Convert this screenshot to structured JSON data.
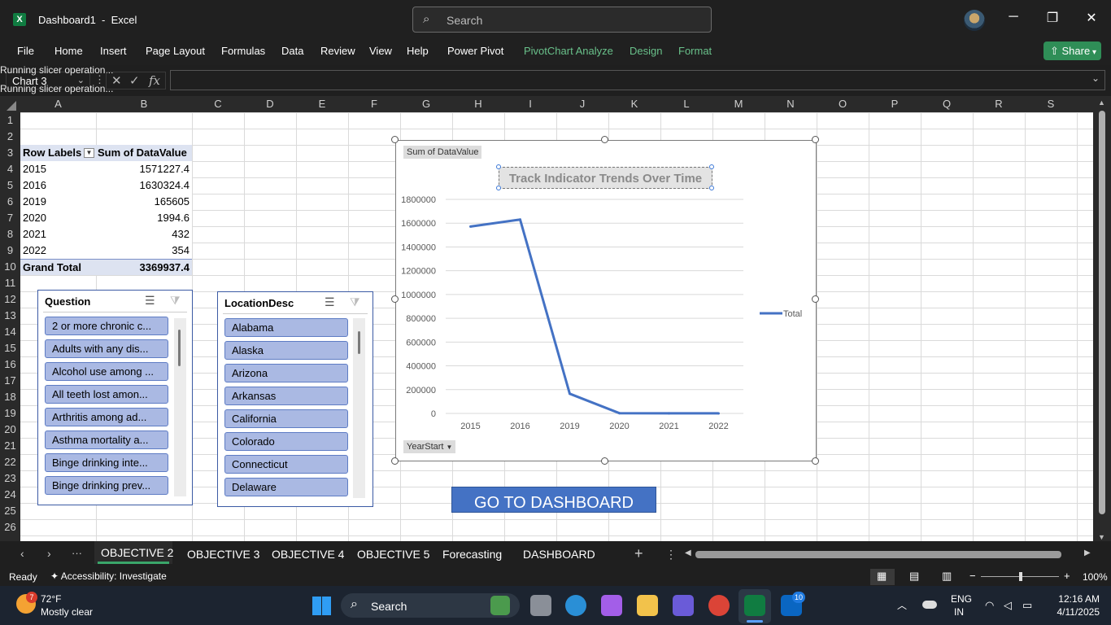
{
  "window": {
    "title": "Dashboard1  -  Excel",
    "search_placeholder": "Search",
    "minimize": "─",
    "maximize": "❐",
    "close": "✕"
  },
  "ribbon": {
    "tabs": [
      "File",
      "Home",
      "Insert",
      "Page Layout",
      "Formulas",
      "Data",
      "Review",
      "View",
      "Help",
      "Power Pivot"
    ],
    "context_tabs": [
      "PivotChart Analyze",
      "Design",
      "Format"
    ],
    "share_label": "Share"
  },
  "formula_bar": {
    "name_box": "Chart 3",
    "status_lines": [
      "Running slicer operation...",
      "Running slicer operation..."
    ],
    "fx": "fx",
    "value": ""
  },
  "columns": [
    "A",
    "B",
    "C",
    "D",
    "E",
    "F",
    "G",
    "H",
    "I",
    "J",
    "K",
    "L",
    "M",
    "N",
    "O",
    "P",
    "Q",
    "R",
    "S"
  ],
  "rows": [
    "1",
    "2",
    "3",
    "4",
    "5",
    "6",
    "7",
    "8",
    "9",
    "10",
    "11",
    "12",
    "13",
    "14",
    "15",
    "16",
    "17",
    "18",
    "19",
    "20",
    "21",
    "22",
    "23",
    "24",
    "25",
    "26"
  ],
  "pivot": {
    "header_label": "Row Labels",
    "header_value": "Sum of DataValue",
    "rows": [
      {
        "label": "2015",
        "value": "1571227.4"
      },
      {
        "label": "2016",
        "value": "1630324.4"
      },
      {
        "label": "2019",
        "value": "165605"
      },
      {
        "label": "2020",
        "value": "1994.6"
      },
      {
        "label": "2021",
        "value": "432"
      },
      {
        "label": "2022",
        "value": "354"
      }
    ],
    "total_label": "Grand Total",
    "total_value": "3369937.4"
  },
  "slicer_question": {
    "title": "Question",
    "items": [
      "2 or more chronic c...",
      "Adults with any dis...",
      "Alcohol use among ...",
      "All teeth lost amon...",
      "Arthritis among ad...",
      "Asthma mortality a...",
      "Binge drinking inte...",
      "Binge drinking prev..."
    ]
  },
  "slicer_location": {
    "title": "LocationDesc",
    "items": [
      "Alabama",
      "Alaska",
      "Arizona",
      "Arkansas",
      "California",
      "Colorado",
      "Connecticut",
      "Delaware"
    ]
  },
  "chart_data": {
    "type": "line",
    "title": "Track Indicator Trends Over Time",
    "value_field_button": "Sum of DataValue",
    "axis_field_button": "YearStart",
    "categories": [
      "2015",
      "2016",
      "2019",
      "2020",
      "2021",
      "2022"
    ],
    "series": [
      {
        "name": "Total",
        "values": [
          1571227.4,
          1630324.4,
          165605,
          1994.6,
          432,
          354
        ],
        "color": "#4472c4"
      }
    ],
    "ylim": [
      0,
      1800000
    ],
    "yticks": [
      "0",
      "200000",
      "400000",
      "600000",
      "800000",
      "1000000",
      "1200000",
      "1400000",
      "1600000",
      "1800000"
    ],
    "grid": true,
    "legend": "right"
  },
  "shape_button": {
    "label": "GO TO DASHBOARD"
  },
  "sheet_tabs": {
    "tabs": [
      "OBJECTIVE 2",
      "OBJECTIVE 3",
      "OBJECTIVE 4",
      "OBJECTIVE 5",
      "Forecasting",
      "DASHBOARD"
    ],
    "active": "OBJECTIVE 2",
    "add": "+",
    "more": "⋮",
    "ellipsis": "···"
  },
  "status_bar": {
    "ready": "Ready",
    "accessibility": "Accessibility: Investigate",
    "zoom": "100%"
  },
  "taskbar": {
    "weather_temp": "72°F",
    "weather_desc": "Mostly clear",
    "weather_badge": "7",
    "search": "Search",
    "lang1": "ENG",
    "lang2": "IN",
    "time": "12:16 AM",
    "date": "4/11/2025",
    "linkedin_badge": "10"
  }
}
